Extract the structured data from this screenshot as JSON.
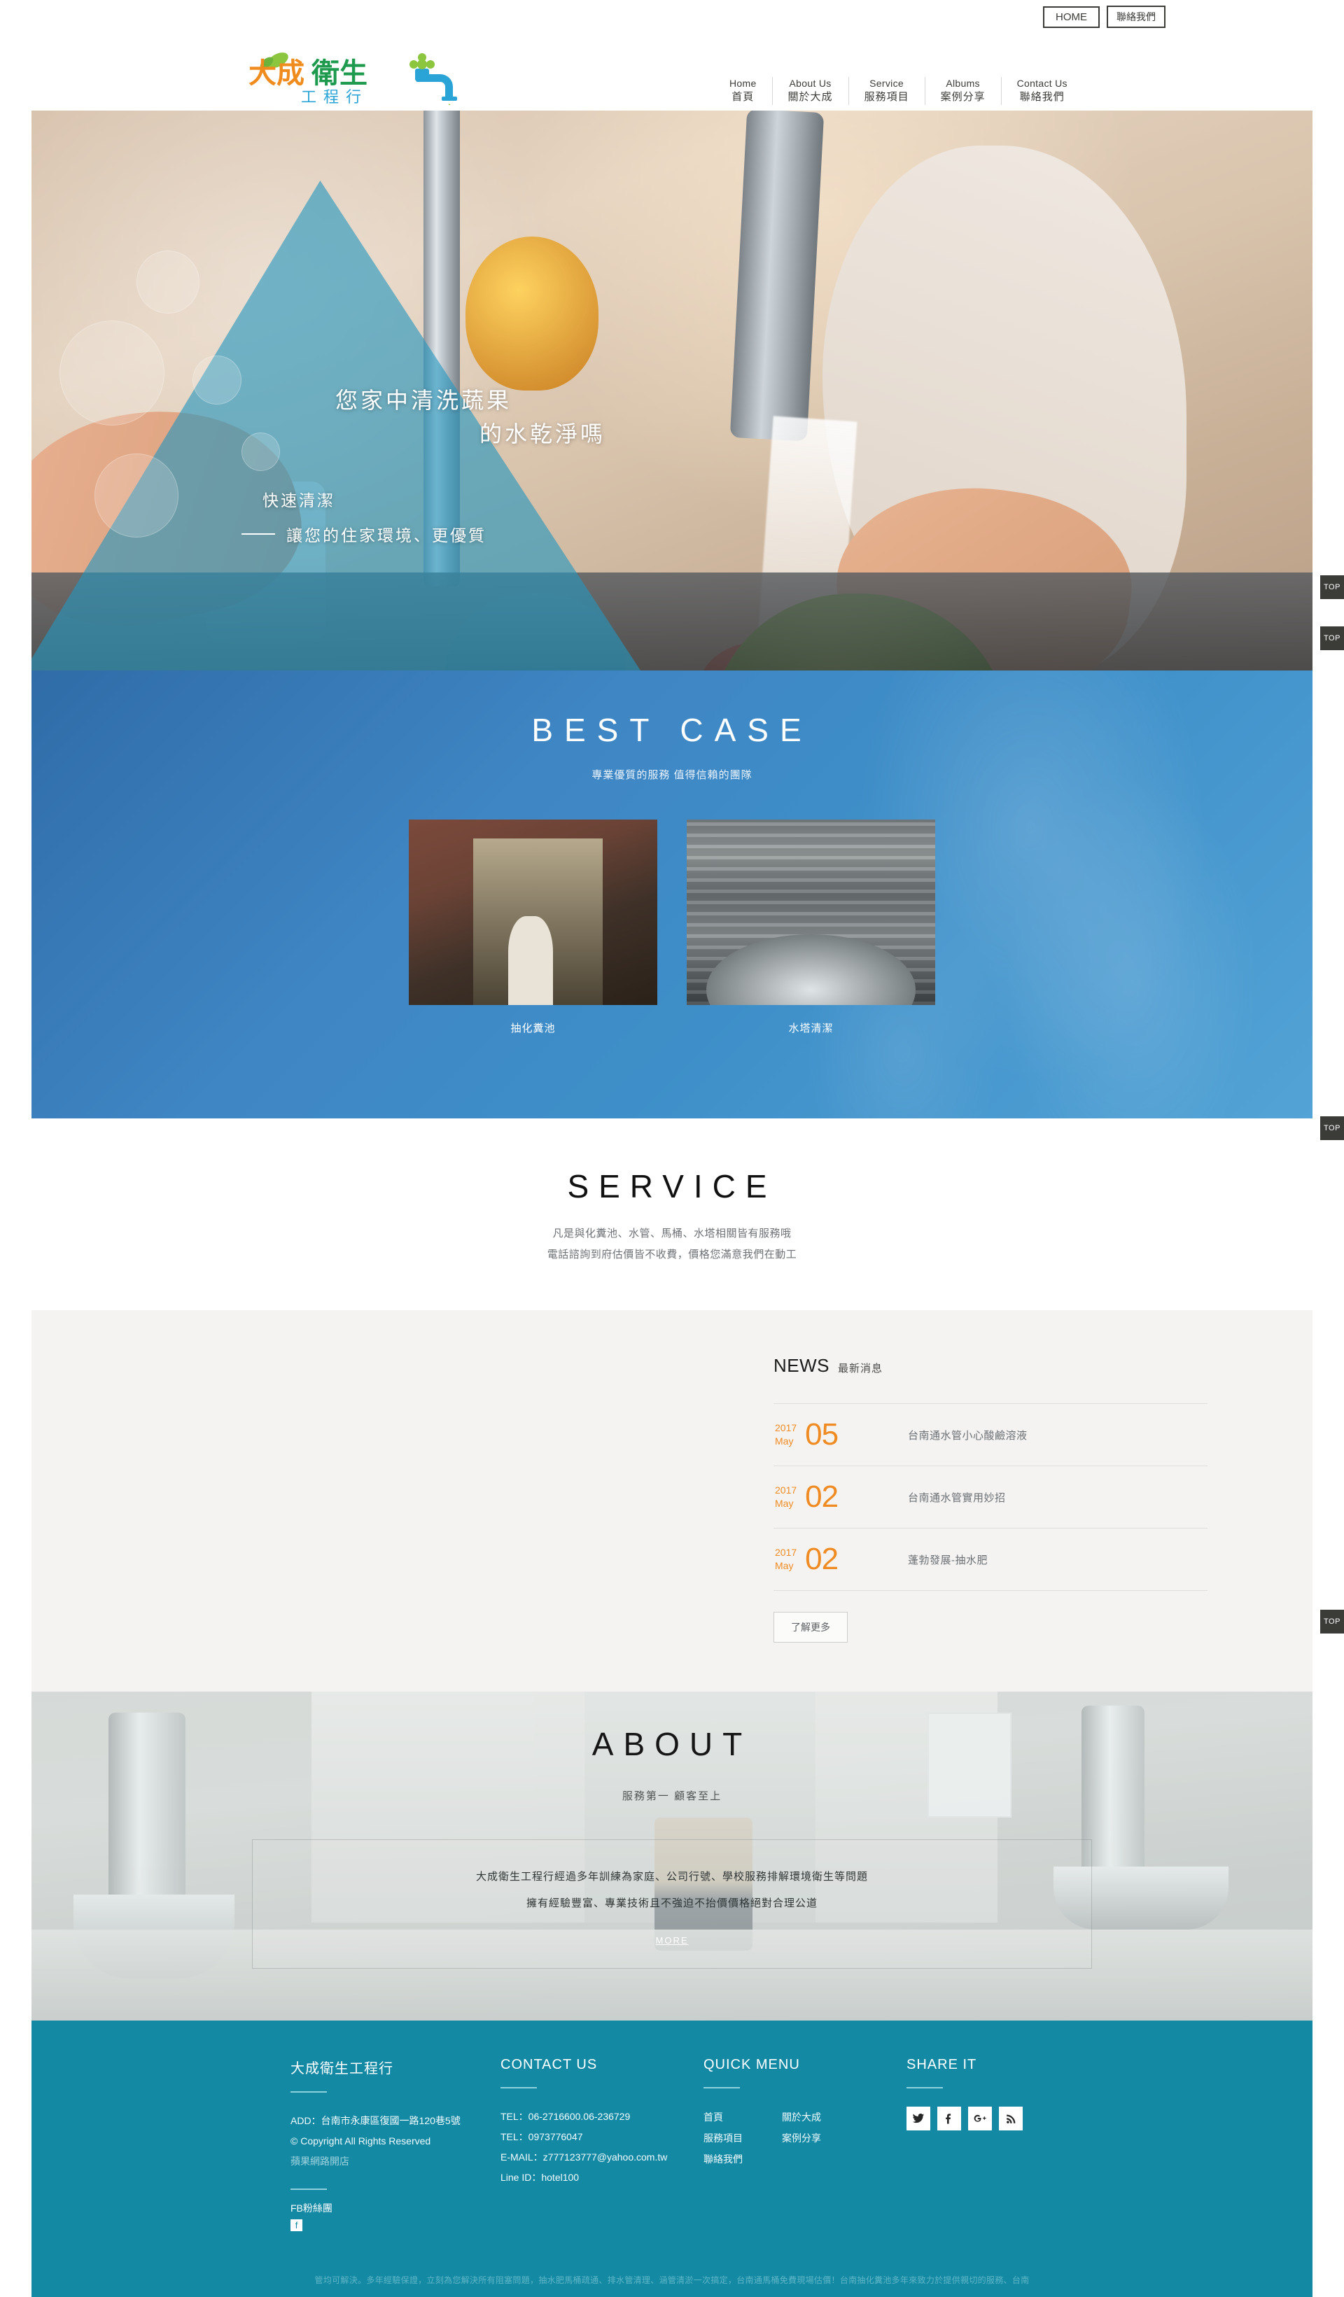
{
  "topbar": {
    "home_label": "HOME",
    "contact_label": "聯絡我們"
  },
  "logo": {
    "line1_orange": "大成",
    "line1_green": "衛生",
    "line2_blue": "工程行",
    "alt": "大成衛生工程行"
  },
  "nav": [
    {
      "en": "Home",
      "zh": "首頁"
    },
    {
      "en": "About Us",
      "zh": "關於大成"
    },
    {
      "en": "Service",
      "zh": "服務項目"
    },
    {
      "en": "Albums",
      "zh": "案例分享"
    },
    {
      "en": "Contact Us",
      "zh": "聯絡我們"
    }
  ],
  "hero": {
    "line1": "您家中清洗蔬果",
    "line2": "的水乾淨嗎",
    "line3": "快速清潔",
    "line4": "讓您的住家環境、更優質"
  },
  "bestcase": {
    "title": "BEST CASE",
    "subtitle": "專業優質的服務 值得信賴的團隊",
    "cards": [
      {
        "caption": "抽化糞池"
      },
      {
        "caption": "水塔清潔"
      }
    ]
  },
  "service": {
    "title": "SERVICE",
    "line1": "凡是與化糞池、水管、馬桶、水塔相關皆有服務哦",
    "line2": "電話諮詢到府估價皆不收費，價格您滿意我們在動工"
  },
  "news": {
    "heading_en": "NEWS",
    "heading_zh": "最新消息",
    "items": [
      {
        "year": "2017",
        "month": "May",
        "day": "05",
        "title": "台南通水管小心酸鹼溶液"
      },
      {
        "year": "2017",
        "month": "May",
        "day": "02",
        "title": "台南通水管實用妙招"
      },
      {
        "year": "2017",
        "month": "May",
        "day": "02",
        "title": "蓬勃發展-抽水肥"
      }
    ],
    "more_label": "了解更多"
  },
  "about": {
    "title": "ABOUT",
    "subtitle": "服務第一 顧客至上",
    "p1": "大成衛生工程行經過多年訓練為家庭、公司行號、學校服務排解環境衛生等問題",
    "p2": "擁有經驗豐富、專業技術且不強迫不抬價價格絕對合理公道",
    "more_label": "MORE"
  },
  "footer": {
    "col1": {
      "heading": "大成衛生工程行",
      "address": "ADD：台南市永康區復國一路120巷5號",
      "copyright": "© Copyright All Rights Reserved",
      "vendor": "蘋果網路開店",
      "fb_label": "FB粉絲團"
    },
    "col2": {
      "heading": "CONTACT US",
      "tel1": "TEL：06-2716600.06-236729",
      "tel2": "TEL：0973776047",
      "email": "E-MAIL：z777123777@yahoo.com.tw",
      "line_id": "Line ID：hotel100"
    },
    "col3": {
      "heading": "QUICK MENU",
      "left": [
        "首頁",
        "服務項目",
        "聯絡我們"
      ],
      "right": [
        "關於大成",
        "案例分享"
      ]
    },
    "col4": {
      "heading": "SHARE IT",
      "social": [
        "twitter-icon",
        "facebook-icon",
        "google-plus-icon",
        "rss-icon"
      ]
    },
    "seo_text": "管均可解決。多年經驗保證，立刻為您解決所有阻塞問題，抽水肥馬桶疏通、排水管清理、涵管清淤一次搞定，台南通馬桶免費現場估價！台南抽化糞池多年來致力於提供親切的服務、台南"
  },
  "top_buttons": [
    {
      "label": "TOP"
    },
    {
      "label": "TOP"
    },
    {
      "label": "TOP"
    },
    {
      "label": "TOP"
    }
  ],
  "colors": {
    "brand_teal": "#1489a4",
    "accent_orange": "#ef8b22",
    "logo_orange": "#f08b1d",
    "logo_green": "#1d9a4e",
    "logo_blue": "#2aa3d6",
    "best_case_blue": "#3f86c4"
  }
}
